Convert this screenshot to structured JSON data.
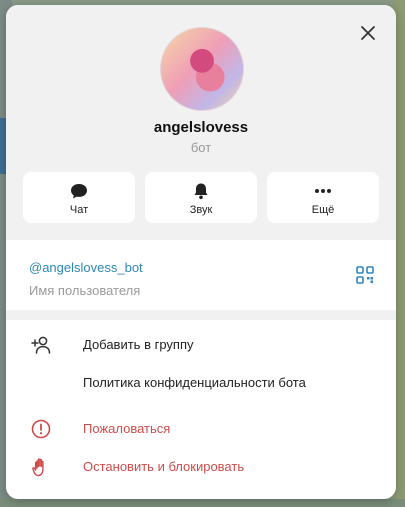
{
  "profile": {
    "name": "angelslovess",
    "subtitle": "бот",
    "avatar_icon": "profile-photo"
  },
  "actions": [
    {
      "label": "Чат",
      "icon": "chat-bubble-icon"
    },
    {
      "label": "Звук",
      "icon": "bell-icon"
    },
    {
      "label": "Ещё",
      "icon": "more-dots-icon"
    }
  ],
  "info": {
    "username": "@angelslovess_bot",
    "username_caption": "Имя пользователя",
    "qr_icon": "qr-code-icon"
  },
  "menu": [
    {
      "label": "Добавить в группу",
      "icon": "add-user-icon",
      "danger": false
    },
    {
      "label": "Политика конфиденциальности бота",
      "icon": "",
      "danger": false
    },
    {
      "label": "Пожаловаться",
      "icon": "alert-circle-icon",
      "danger": true
    },
    {
      "label": "Остановить и блокировать",
      "icon": "hand-stop-icon",
      "danger": true
    }
  ],
  "colors": {
    "accent": "#2f87b8",
    "danger": "#cf4b4b",
    "muted": "#9a9a9a",
    "panel_bg": "#f1f1f1"
  }
}
